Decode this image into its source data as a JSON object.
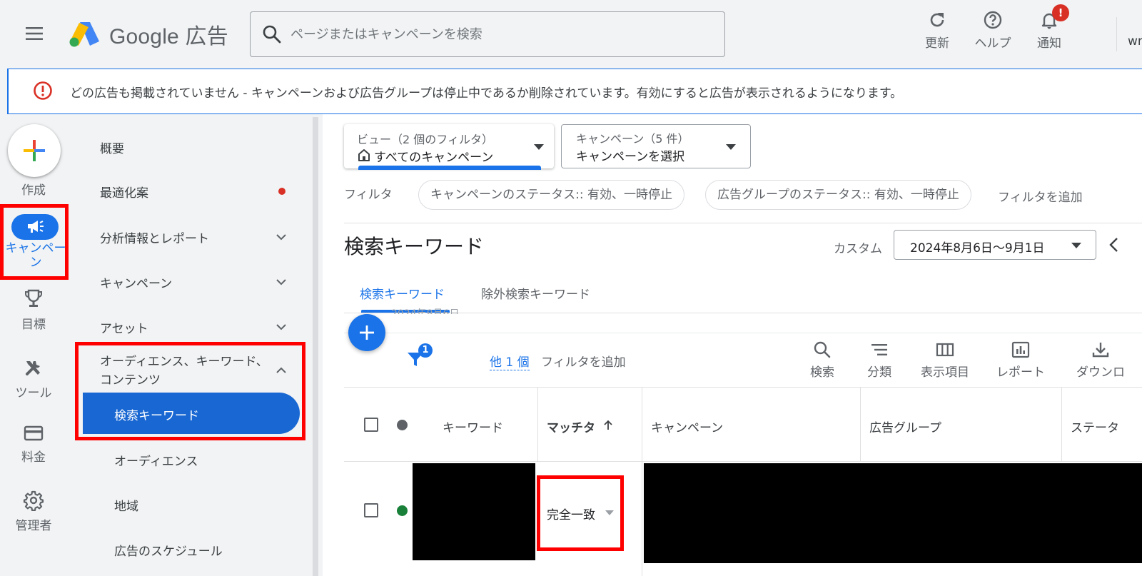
{
  "header": {
    "logo_text": "Google 広告",
    "search_placeholder": "ページまたはキャンペーンを検索",
    "refresh_label": "更新",
    "help_label": "ヘルプ",
    "notifications_label": "通知",
    "notifications_badge": "!",
    "account_fragment": "wr"
  },
  "alert": {
    "text": "どの広告も掲載されていません - キャンペーンおよび広告グループは停止中であるか削除されています。有効にすると広告が表示されるようになります。"
  },
  "rail": {
    "create_label": "作成",
    "campaigns_label": "キャンペーン",
    "goals_label": "目標",
    "tools_label": "ツール",
    "billing_label": "料金",
    "admin_label": "管理者"
  },
  "nav": {
    "overview": "概要",
    "recommendations": "最適化案",
    "insights": "分析情報とレポート",
    "campaigns": "キャンペーン",
    "assets": "アセット",
    "audiences_group": "オーディエンス、キーワード、コンテンツ",
    "search_keywords": "検索キーワード",
    "audiences": "オーディエンス",
    "locations": "地域",
    "ad_schedule": "広告のスケジュール"
  },
  "view_dropdown": {
    "caption": "ビュー（2 個のフィルタ）",
    "value": "すべてのキャンペーン"
  },
  "campaign_dropdown": {
    "caption": "キャンペーン（5 件）",
    "value": "キャンペーンを選択"
  },
  "filters": {
    "label": "フィルタ",
    "chips": [
      "キャンペーンのステータス:: 有効、一時停止",
      "広告グループのステータス:: 有効、一時停止"
    ],
    "add_filter": "フィルタを追加"
  },
  "page_title": "検索キーワード",
  "date_range": {
    "label": "カスタム",
    "value": "2024年8月6日〜9月1日"
  },
  "tabs": {
    "keywords": "検索キーワード",
    "negative": "除外検索キーワード"
  },
  "faded_date": "2024年8月6日",
  "toolbar": {
    "filter_badge": "1",
    "more_filter": "他 1 個",
    "add_filter": "フィルタを追加",
    "search": "検索",
    "segment": "分類",
    "columns": "表示項目",
    "reports": "レポート",
    "download": "ダウンロ"
  },
  "table": {
    "headers": {
      "keyword": "キーワード",
      "match_type": "マッチタ",
      "campaign": "キャンペーン",
      "ad_group": "広告グループ",
      "status": "ステータ"
    },
    "rows": [
      {
        "match_type": "完全一致"
      }
    ]
  },
  "colors": {
    "accent": "#1a73e8",
    "alert_red": "#d93025",
    "enabled_green": "#188038",
    "highlight_red": "#ff0000"
  }
}
